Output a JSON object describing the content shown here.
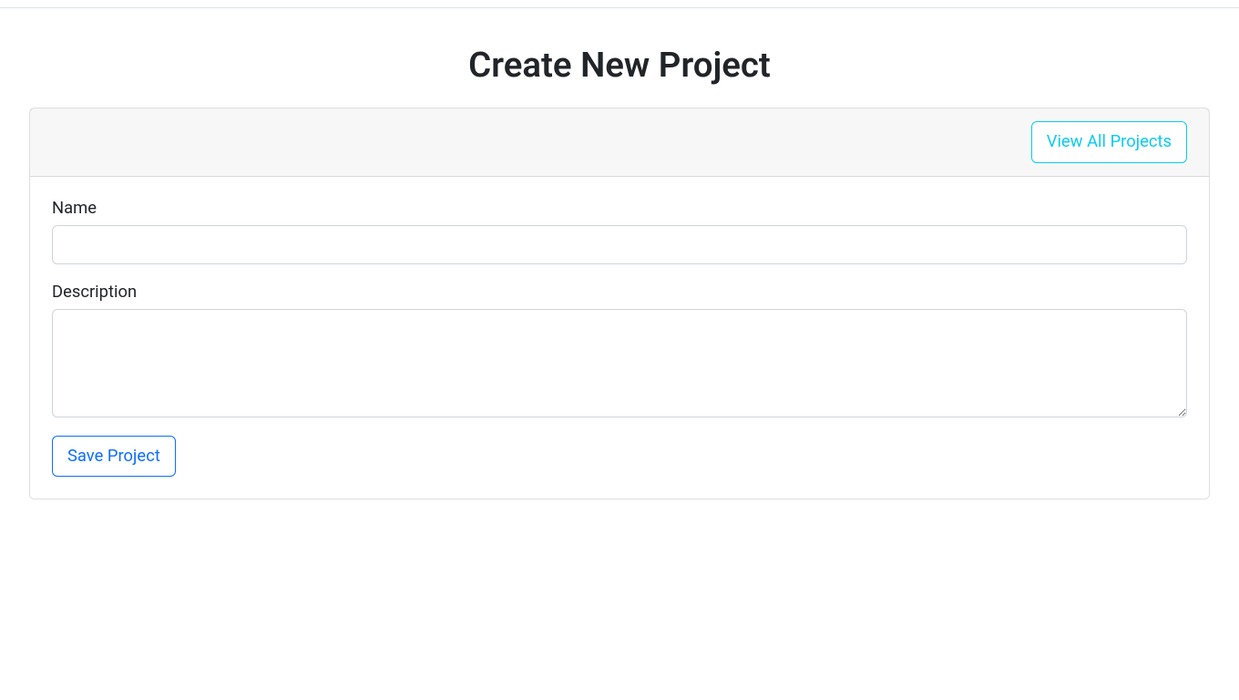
{
  "page": {
    "title": "Create New Project"
  },
  "header": {
    "view_all_label": "View All Projects"
  },
  "form": {
    "name": {
      "label": "Name",
      "value": ""
    },
    "description": {
      "label": "Description",
      "value": ""
    },
    "submit_label": "Save Project"
  }
}
